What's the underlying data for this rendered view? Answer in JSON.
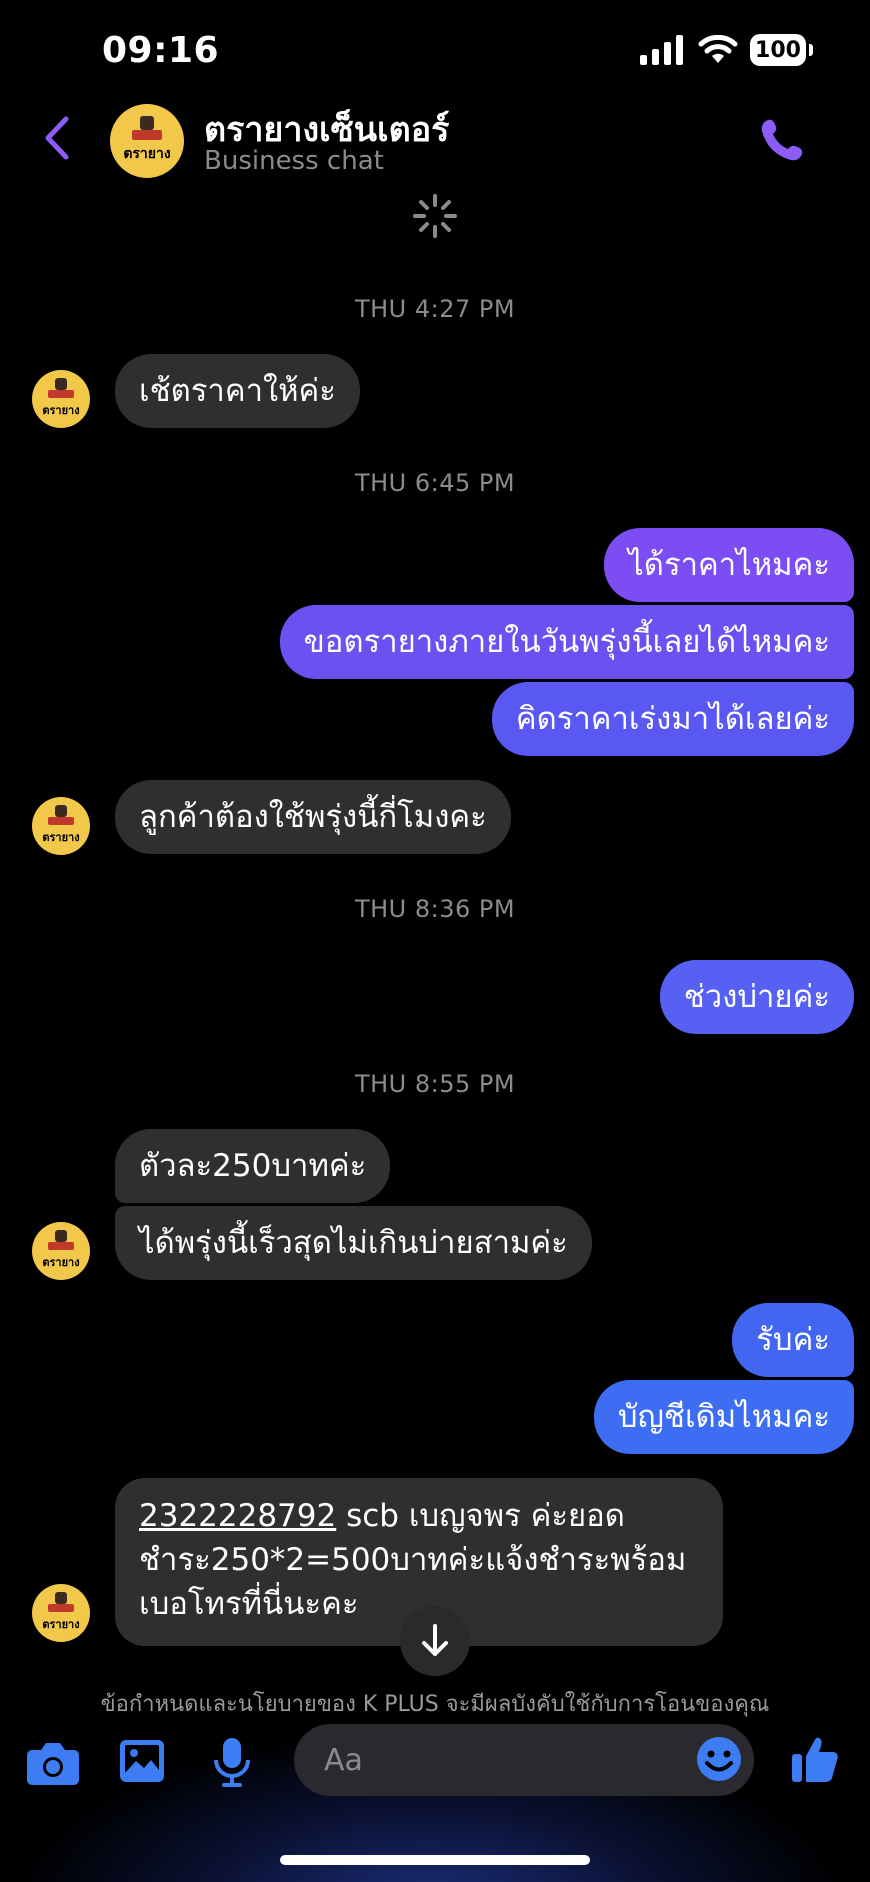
{
  "status": {
    "time": "09:16",
    "battery": "100"
  },
  "header": {
    "name": "ตรายางเซ็นเตอร์",
    "subtitle": "Business chat",
    "avatar_text": "ตรายาง"
  },
  "timestamps": [
    "THU 4:27 PM",
    "THU 6:45 PM",
    "THU 8:36 PM",
    "THU 8:55 PM"
  ],
  "messages": {
    "m1": "เช้ตราคาให้ค่ะ",
    "m2": "ได้ราคาไหมคะ",
    "m3": "ขอตรายางภายในวันพรุ่งนี้เลยได้ไหมคะ",
    "m4": "คิดราคาเร่งมาได้เลยค่ะ",
    "m5": "ลูกค้าต้องใช้พรุ่งนี้กี่โมงคะ",
    "m6": "ช่วงบ่ายค่ะ",
    "m7": "ตัวละ250บาทค่ะ",
    "m8": "ได้พรุ่งนี้เร็วสุดไม่เกินบ่ายสามค่ะ",
    "m9": "รับค่ะ",
    "m10": "บัญชีเดิมไหมคะ",
    "m11_account": "2322228792",
    "m11_rest": "  scb เบญจพร ค่ะยอดชำระ250*2=500บาทค่ะแจ้งชำระพร้อมเบอโทรที่นี่นะคะ"
  },
  "policy_text": "ข้อกำหนดและนโยบายของ K PLUS จะมีผลบังคับใช้กับการโอนของคุณ",
  "composer": {
    "placeholder": "Aa"
  },
  "colors": {
    "accent": "#8b5cf6",
    "in_bubble": "#2f2f32",
    "out_top": "#7b4df2",
    "out_bottom": "#3d6df2",
    "avatar": "#f2c84b"
  }
}
